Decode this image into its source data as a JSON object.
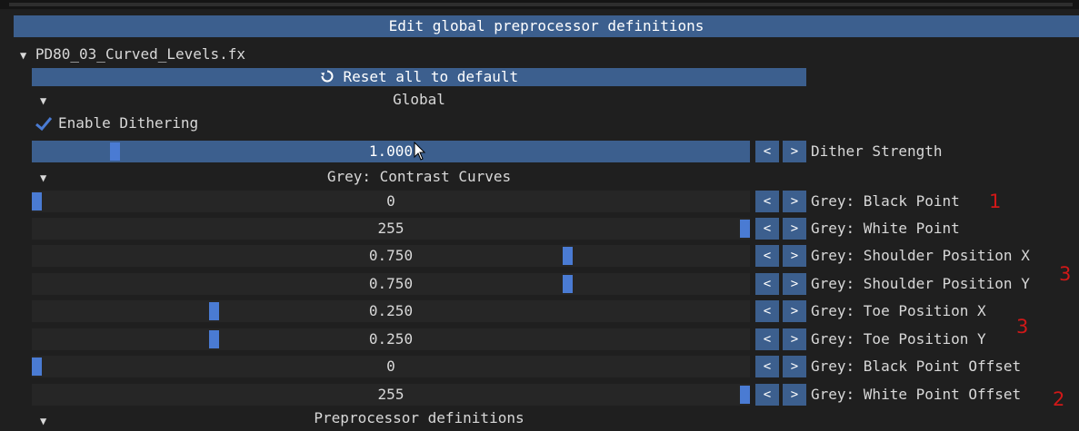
{
  "window": {
    "title": "Edit global preprocessor definitions"
  },
  "tree": {
    "file_node": "PD80_03_Curved_Levels.fx",
    "reset_label": "Reset all to default",
    "sections": {
      "global": "Global",
      "grey": "Grey: Contrast Curves",
      "preproc": "Preprocessor definitions"
    }
  },
  "checkbox": {
    "label": "Enable Dithering",
    "checked": true
  },
  "buttons": {
    "dec": "<",
    "inc": ">"
  },
  "params": [
    {
      "value": "1.000",
      "label": "Dither Strength",
      "fraction": 0.11
    },
    {
      "value": "0",
      "label": "Grey: Black Point",
      "fraction": 0.0
    },
    {
      "value": "255",
      "label": "Grey: White Point",
      "fraction": 1.0
    },
    {
      "value": "0.750",
      "label": "Grey: Shoulder Position X",
      "fraction": 0.75
    },
    {
      "value": "0.750",
      "label": "Grey: Shoulder Position Y",
      "fraction": 0.75
    },
    {
      "value": "0.250",
      "label": "Grey: Toe Position X",
      "fraction": 0.25
    },
    {
      "value": "0.250",
      "label": "Grey: Toe Position Y",
      "fraction": 0.25
    },
    {
      "value": "0",
      "label": "Grey: Black Point Offset",
      "fraction": 0.0
    },
    {
      "value": "255",
      "label": "Grey: White Point Offset",
      "fraction": 1.0
    }
  ],
  "annotations": {
    "a1": "1",
    "a3a": "3",
    "a3b": "3",
    "a2": "2"
  },
  "colors": {
    "accent": "#3c5f8e",
    "grab": "#4a7bd3",
    "annotation": "#d01818"
  }
}
